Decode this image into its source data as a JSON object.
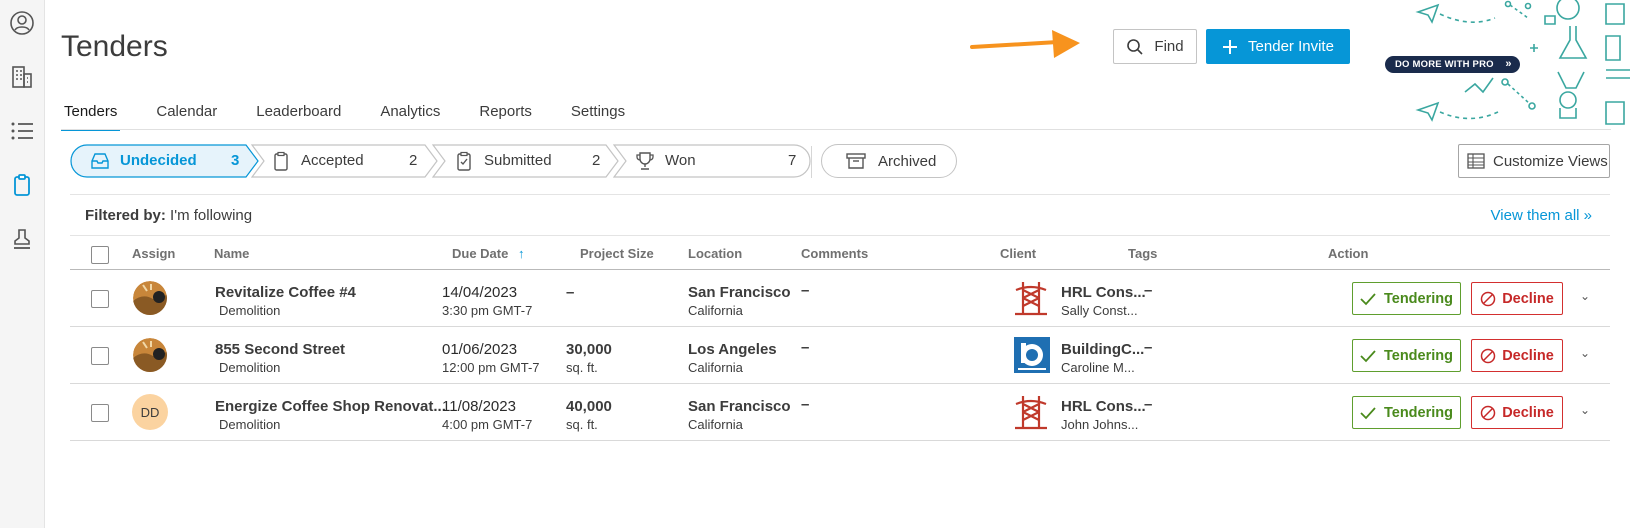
{
  "sidebar": {
    "items": [
      {
        "icon": "user-circle-icon"
      },
      {
        "icon": "building-icon"
      },
      {
        "icon": "list-icon"
      },
      {
        "icon": "clipboard-icon",
        "active": true
      },
      {
        "icon": "stamp-icon"
      }
    ]
  },
  "header": {
    "title": "Tenders",
    "find_label": "Find",
    "invite_label": "Tender Invite",
    "pro_badge": "DO MORE WITH PRO"
  },
  "tabs": [
    "Tenders",
    "Calendar",
    "Leaderboard",
    "Analytics",
    "Reports",
    "Settings"
  ],
  "stages": [
    {
      "label": "Undecided",
      "count": "3",
      "icon": "inbox-icon"
    },
    {
      "label": "Accepted",
      "count": "2",
      "icon": "clipboard-icon"
    },
    {
      "label": "Submitted",
      "count": "2",
      "icon": "clipboard-check-icon"
    },
    {
      "label": "Won",
      "count": "7",
      "icon": "trophy-icon"
    }
  ],
  "archived_label": "Archived",
  "customize_label": "Customize Views",
  "filter": {
    "prefix": "Filtered by:",
    "value": "I'm following",
    "view_all": "View them all »"
  },
  "columns": {
    "assign": "Assign",
    "name": "Name",
    "due": "Due Date",
    "size": "Project Size",
    "location": "Location",
    "comments": "Comments",
    "client": "Client",
    "tags": "Tags",
    "action": "Action"
  },
  "rows": [
    {
      "name": "Revitalize Coffee #4",
      "type": "Demolition",
      "date": "14/04/2023",
      "time": "3:30 pm GMT-7",
      "size": "–",
      "size_unit": "",
      "city": "San Francisco",
      "state": "California",
      "comments": "–",
      "client": "HRL Cons...",
      "contact": "Sally Const...",
      "tags": "–",
      "assign": "photo"
    },
    {
      "name": "855 Second Street",
      "type": "Demolition",
      "date": "01/06/2023",
      "time": "12:00 pm GMT-7",
      "size": "30,000",
      "size_unit": "sq. ft.",
      "city": "Los Angeles",
      "state": "California",
      "comments": "–",
      "client": "BuildingC...",
      "contact": "Caroline M...",
      "tags": "–",
      "assign": "photo"
    },
    {
      "name": "Energize Coffee Shop Renovat...",
      "type": "Demolition",
      "date": "11/08/2023",
      "time": "4:00 pm GMT-7",
      "size": "40,000",
      "size_unit": "sq. ft.",
      "city": "San Francisco",
      "state": "California",
      "comments": "–",
      "client": "HRL Cons...",
      "contact": "John Johns...",
      "tags": "–",
      "assign": "DD"
    }
  ],
  "actions": {
    "tendering": "Tendering",
    "decline": "Decline"
  },
  "colors": {
    "accent": "#0696d7",
    "green": "#4a8a1c",
    "red": "#c62828",
    "pro": "#1a2b4c",
    "arrow": "#f7931e"
  }
}
